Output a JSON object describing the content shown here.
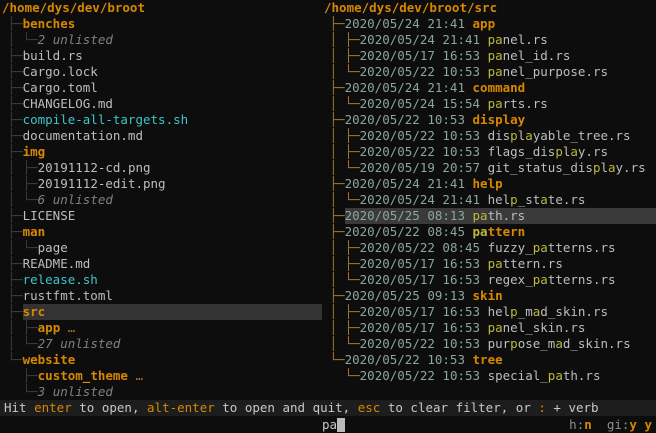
{
  "colors": {
    "background": "#0d0d0d",
    "directory_orange": "#d78700",
    "file_gray": "#bdbdbd",
    "executable_cyan": "#3fc3cb",
    "match_yellow": "#bdb93b",
    "date_graygreen": "#8aa5a0",
    "unlisted_gray": "#818181",
    "tree_line_left": "#3d3d3d",
    "tree_line_right": "#a5762b",
    "selection_bg": "#3a3a3a",
    "statusbar_bg": "#1d1d1d"
  },
  "left_panel": {
    "root": "/home/dys/dev/broot",
    "rows": [
      {
        "prefix": " ├─",
        "segs": [
          [
            "benches",
            "dir"
          ]
        ]
      },
      {
        "prefix": " │ └─",
        "segs": [
          [
            "2 unlisted",
            "unl"
          ]
        ]
      },
      {
        "prefix": " ├─",
        "segs": [
          [
            "build.rs",
            "file"
          ]
        ]
      },
      {
        "prefix": " ├─",
        "segs": [
          [
            "Cargo.lock",
            "file"
          ]
        ]
      },
      {
        "prefix": " ├─",
        "segs": [
          [
            "Cargo.toml",
            "file"
          ]
        ]
      },
      {
        "prefix": " ├─",
        "segs": [
          [
            "CHANGELOG.md",
            "file"
          ]
        ]
      },
      {
        "prefix": " ├─",
        "segs": [
          [
            "compile-all-targets.sh",
            "exe"
          ]
        ]
      },
      {
        "prefix": " ├─",
        "segs": [
          [
            "documentation.md",
            "file"
          ]
        ]
      },
      {
        "prefix": " ├─",
        "segs": [
          [
            "img",
            "dir"
          ]
        ]
      },
      {
        "prefix": " │ ├─",
        "segs": [
          [
            "20191112-cd.png",
            "file"
          ]
        ]
      },
      {
        "prefix": " │ ├─",
        "segs": [
          [
            "20191112-edit.png",
            "file"
          ]
        ]
      },
      {
        "prefix": " │ └─",
        "segs": [
          [
            "6 unlisted",
            "unl"
          ]
        ]
      },
      {
        "prefix": " ├─",
        "segs": [
          [
            "LICENSE",
            "file"
          ]
        ]
      },
      {
        "prefix": " ├─",
        "segs": [
          [
            "man",
            "dir"
          ]
        ]
      },
      {
        "prefix": " │ └─",
        "segs": [
          [
            "page",
            "file"
          ]
        ]
      },
      {
        "prefix": " ├─",
        "segs": [
          [
            "README.md",
            "file"
          ]
        ]
      },
      {
        "prefix": " ├─",
        "segs": [
          [
            "release.sh",
            "exe"
          ]
        ]
      },
      {
        "prefix": " ├─",
        "segs": [
          [
            "rustfmt.toml",
            "file"
          ]
        ]
      },
      {
        "prefix": " ├─",
        "segs": [
          [
            "src",
            "dir"
          ]
        ],
        "selected": true
      },
      {
        "prefix": " │ ├─",
        "segs": [
          [
            "app",
            "dir"
          ],
          [
            " …",
            "dots"
          ]
        ]
      },
      {
        "prefix": " │ └─",
        "segs": [
          [
            "27 unlisted",
            "unl"
          ]
        ]
      },
      {
        "prefix": " └─",
        "segs": [
          [
            "website",
            "dir"
          ]
        ]
      },
      {
        "prefix": "   ├─",
        "segs": [
          [
            "custom_theme",
            "dir"
          ],
          [
            " …",
            "dots"
          ]
        ]
      },
      {
        "prefix": "   └─",
        "segs": [
          [
            "3 unlisted",
            "unl"
          ]
        ]
      }
    ]
  },
  "right_panel": {
    "root": "/home/dys/dev/broot/src",
    "rows": [
      {
        "prefix": " ├─",
        "date": "2020/05/24 21:41",
        "segs": [
          [
            "app",
            "dir"
          ]
        ]
      },
      {
        "prefix": " │ ├─",
        "date": "2020/05/24 21:41",
        "segs": [
          [
            "pa",
            "match"
          ],
          [
            "nel.rs",
            "file"
          ]
        ]
      },
      {
        "prefix": " │ ├─",
        "date": "2020/05/17 16:53",
        "segs": [
          [
            "pa",
            "match"
          ],
          [
            "nel_id.rs",
            "file"
          ]
        ]
      },
      {
        "prefix": " │ └─",
        "date": "2020/05/22 10:53",
        "segs": [
          [
            "pa",
            "match"
          ],
          [
            "nel_purpose.rs",
            "file"
          ]
        ]
      },
      {
        "prefix": " ├─",
        "date": "2020/05/24 21:41",
        "segs": [
          [
            "command",
            "dir"
          ]
        ]
      },
      {
        "prefix": " │ └─",
        "date": "2020/05/24 15:54",
        "segs": [
          [
            "pa",
            "match"
          ],
          [
            "rts.rs",
            "file"
          ]
        ]
      },
      {
        "prefix": " ├─",
        "date": "2020/05/22 10:53",
        "segs": [
          [
            "display",
            "dir"
          ]
        ]
      },
      {
        "prefix": " │ ├─",
        "date": "2020/05/22 10:53",
        "segs": [
          [
            "dis",
            "file"
          ],
          [
            "p",
            "match"
          ],
          [
            "l",
            "file"
          ],
          [
            "a",
            "match"
          ],
          [
            "yable_tree.rs",
            "file"
          ]
        ]
      },
      {
        "prefix": " │ ├─",
        "date": "2020/05/22 10:53",
        "segs": [
          [
            "flags_dis",
            "file"
          ],
          [
            "p",
            "match"
          ],
          [
            "l",
            "file"
          ],
          [
            "a",
            "match"
          ],
          [
            "y.rs",
            "file"
          ]
        ]
      },
      {
        "prefix": " │ └─",
        "date": "2020/05/19 20:57",
        "segs": [
          [
            "git_status_dis",
            "file"
          ],
          [
            "p",
            "match"
          ],
          [
            "l",
            "file"
          ],
          [
            "a",
            "match"
          ],
          [
            "y.rs",
            "file"
          ]
        ]
      },
      {
        "prefix": " ├─",
        "date": "2020/05/24 21:41",
        "segs": [
          [
            "help",
            "dir"
          ]
        ]
      },
      {
        "prefix": " │ └─",
        "date": "2020/05/24 21:41",
        "segs": [
          [
            "hel",
            "file"
          ],
          [
            "p",
            "match"
          ],
          [
            "_st",
            "file"
          ],
          [
            "a",
            "match"
          ],
          [
            "te.rs",
            "file"
          ]
        ]
      },
      {
        "prefix": " ├─",
        "date": "2020/05/25 08:13",
        "segs": [
          [
            "pa",
            "match"
          ],
          [
            "th.rs",
            "file"
          ]
        ],
        "selected": true
      },
      {
        "prefix": " ├─",
        "date": "2020/05/22 08:45",
        "segs": [
          [
            "pa",
            "matchdir"
          ],
          [
            "ttern",
            "dir"
          ]
        ]
      },
      {
        "prefix": " │ ├─",
        "date": "2020/05/22 08:45",
        "segs": [
          [
            "fuzzy_",
            "file"
          ],
          [
            "pa",
            "match"
          ],
          [
            "tterns.rs",
            "file"
          ]
        ]
      },
      {
        "prefix": " │ ├─",
        "date": "2020/05/17 16:53",
        "segs": [
          [
            "pa",
            "match"
          ],
          [
            "ttern.rs",
            "file"
          ]
        ]
      },
      {
        "prefix": " │ └─",
        "date": "2020/05/17 16:53",
        "segs": [
          [
            "regex_",
            "file"
          ],
          [
            "pa",
            "match"
          ],
          [
            "tterns.rs",
            "file"
          ]
        ]
      },
      {
        "prefix": " ├─",
        "date": "2020/05/25 09:13",
        "segs": [
          [
            "skin",
            "dir"
          ]
        ]
      },
      {
        "prefix": " │ ├─",
        "date": "2020/05/17 16:53",
        "segs": [
          [
            "hel",
            "file"
          ],
          [
            "p",
            "match"
          ],
          [
            "_m",
            "file"
          ],
          [
            "a",
            "match"
          ],
          [
            "d_skin.rs",
            "file"
          ]
        ]
      },
      {
        "prefix": " │ ├─",
        "date": "2020/05/17 16:53",
        "segs": [
          [
            "pa",
            "match"
          ],
          [
            "nel_skin.rs",
            "file"
          ]
        ]
      },
      {
        "prefix": " │ └─",
        "date": "2020/05/22 10:53",
        "segs": [
          [
            "pur",
            "file"
          ],
          [
            "p",
            "match"
          ],
          [
            "ose_m",
            "file"
          ],
          [
            "a",
            "match"
          ],
          [
            "d_skin.rs",
            "file"
          ]
        ]
      },
      {
        "prefix": " └─",
        "date": "2020/05/22 10:53",
        "segs": [
          [
            "tree",
            "dir"
          ]
        ]
      },
      {
        "prefix": "   └─",
        "date": "2020/05/22 10:53",
        "segs": [
          [
            "special_",
            "file"
          ],
          [
            "pa",
            "match"
          ],
          [
            "th.rs",
            "file"
          ]
        ]
      }
    ]
  },
  "status_bar": {
    "segments": [
      [
        "Hit ",
        "text"
      ],
      [
        "enter",
        "key"
      ],
      [
        " to open, ",
        "text"
      ],
      [
        "alt-enter",
        "key"
      ],
      [
        " to open and quit, ",
        "text"
      ],
      [
        "esc",
        "key"
      ],
      [
        " to clear filter, or ",
        "text"
      ],
      [
        ":",
        "key"
      ],
      [
        " + verb",
        "text"
      ]
    ]
  },
  "input_bar": {
    "value": "pa",
    "flags": [
      {
        "label": "h:",
        "value": "n"
      },
      {
        "label": "gi:",
        "value": "y"
      },
      {
        "label": "",
        "value": "y"
      }
    ]
  }
}
